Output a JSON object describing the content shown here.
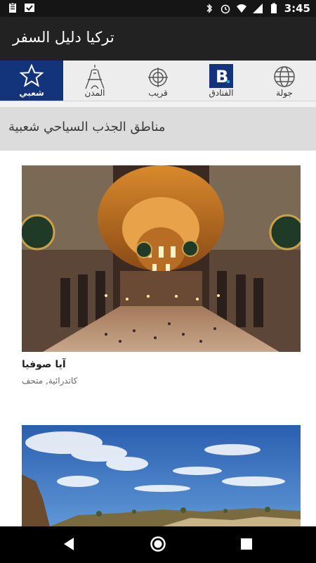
{
  "status_bar": {
    "time": "3:45",
    "left_icons": [
      "clipboard-icon",
      "check-badge-icon"
    ],
    "right_icons": [
      "bluetooth-icon",
      "alarm-icon",
      "wifi-icon",
      "signal-icon",
      "battery-icon"
    ]
  },
  "app_bar": {
    "title": "تركيا دليل السفر"
  },
  "tabs": [
    {
      "label": "شعبي",
      "icon": "star-icon",
      "active": true
    },
    {
      "label": "المدن",
      "icon": "eiffel-tower-icon",
      "active": false
    },
    {
      "label": "قريب",
      "icon": "crosshair-icon",
      "active": false
    },
    {
      "label": "الفنادق",
      "icon": "booking-icon",
      "active": false
    },
    {
      "label": "جولة",
      "icon": "globe-icon",
      "active": false
    }
  ],
  "section": {
    "title": "مناطق الجذب السياحي شعبية"
  },
  "cards": [
    {
      "name": "آيا صوفيا",
      "subtitle": "كاتدرائية, متحف"
    },
    {
      "name": "",
      "subtitle": ""
    }
  ],
  "nav_bar": {
    "buttons": [
      "back-icon",
      "home-icon",
      "recents-icon"
    ]
  },
  "colors": {
    "status_bar": "#151515",
    "app_bar": "#222222",
    "tab_active": "#13337a",
    "tab_bg": "#ededed",
    "section_bg": "#dcdcdc"
  }
}
